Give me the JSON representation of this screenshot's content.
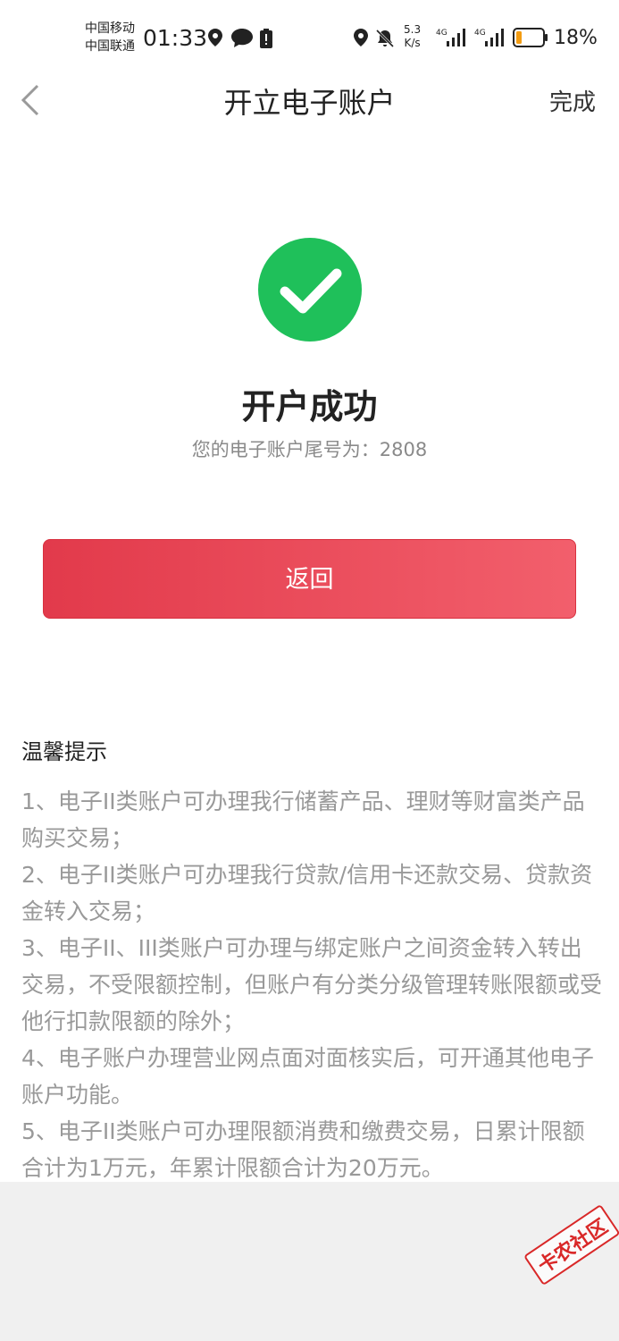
{
  "status_bar": {
    "carrier_1": "中国移动",
    "carrier_2": "中国联通",
    "time": "01:33",
    "net_speed_value": "5.3",
    "net_speed_unit": "K/s",
    "signal_1": "4G",
    "signal_2": "4G",
    "battery": "18%",
    "icons": [
      "location-icon",
      "message-icon",
      "battery-alert-icon",
      "location-icon",
      "mute-bell-icon",
      "signal-icon",
      "battery-icon"
    ]
  },
  "navbar": {
    "title": "开立电子账户",
    "done_label": "完成"
  },
  "result": {
    "title": "开户成功",
    "account_text": "您的电子账户尾号为：2808",
    "icon": "check-circle-icon",
    "icon_color": "#1fc05a"
  },
  "return_button": {
    "label": "返回",
    "color_start": "#e23a4b",
    "color_end": "#f25f6c"
  },
  "tips": {
    "title": "温馨提示",
    "items": [
      "1、电子II类账户可办理我行储蓄产品、理财等财富类产品购买交易；",
      "2、电子II类账户可办理我行贷款/信用卡还款交易、贷款资金转入交易；",
      "3、电子II、III类账户可办理与绑定账户之间资金转入转出交易，不受限额控制，但账户有分类分级管理转账限额或受他行扣款限额的除外；",
      "4、电子账户办理营业网点面对面核实后，可开通其他电子账户功能。",
      "5、电子II类账户可办理限额消费和缴费交易，日累计限额合计为1万元，年累计限额合计为20万元。"
    ]
  },
  "watermark": "卡农社区"
}
